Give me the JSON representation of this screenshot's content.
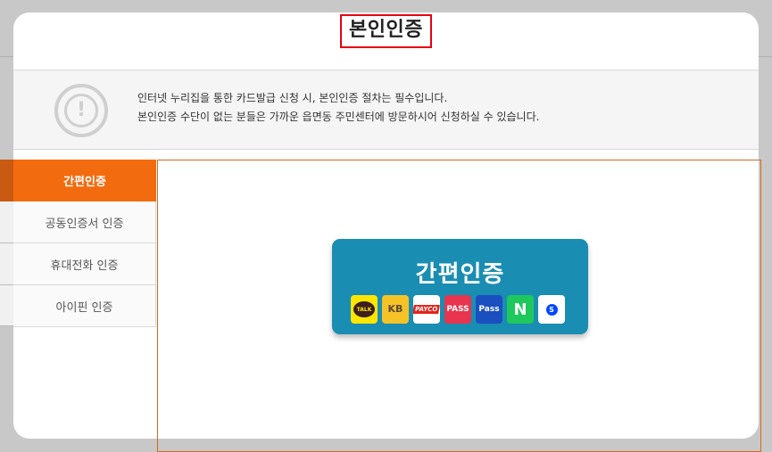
{
  "modal": {
    "title": "본인인증"
  },
  "notice": {
    "line1": "인터넷 누리집을 통한 카드발급 신청 시, 본인인증 절차는 필수입니다.",
    "line2": "본인인증 수단이 없는 분들은 가까운 읍면동 주민센터에 방문하시어 신청하실 수 있습니다.",
    "icon": "alert-circle-icon"
  },
  "sidebar": {
    "items": [
      {
        "label": "간편인증",
        "active": true
      },
      {
        "label": "공동인증서 인증",
        "active": false
      },
      {
        "label": "휴대전화 인증",
        "active": false
      },
      {
        "label": "아이핀 인증",
        "active": false
      }
    ]
  },
  "easy_auth": {
    "title": "간편인증",
    "logos": [
      {
        "name": "kakaotalk-logo",
        "text": "TALK"
      },
      {
        "name": "kb-logo",
        "text": "KB"
      },
      {
        "name": "payco-logo",
        "text": "PAYCO"
      },
      {
        "name": "pass-logo",
        "text": "PASS"
      },
      {
        "name": "pass-blue-logo",
        "text": "Pass"
      },
      {
        "name": "naver-logo",
        "text": "N"
      },
      {
        "name": "shinhan-logo",
        "text": "S"
      }
    ]
  },
  "colors": {
    "accent": "#f26b0f",
    "title_border": "#e60012",
    "card": "#1a8db2",
    "frame": "#d2691e"
  }
}
